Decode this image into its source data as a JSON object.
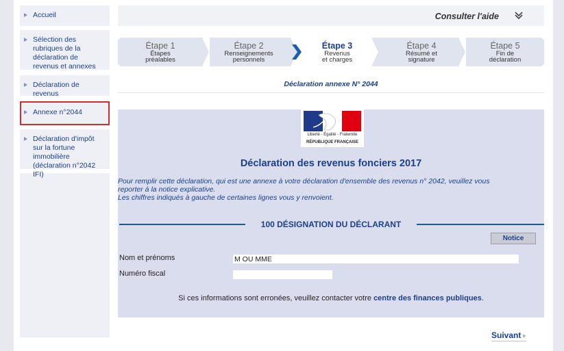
{
  "sidebar": {
    "items": [
      {
        "label": "Accueil"
      },
      {
        "label": "Sélection des rubriques de la déclaration de revenus et annexes"
      },
      {
        "label": "Déclaration de revenus"
      },
      {
        "label": "Annexe n°2044"
      },
      {
        "label": "Déclaration d'impôt sur la fortune immobilière (déclaration n°2042 IFI)"
      }
    ],
    "active_index": 3
  },
  "help": {
    "label": "Consulter l'aide"
  },
  "steps": [
    {
      "num": "Étape 1",
      "line1": "Étapes",
      "line2": "préalables"
    },
    {
      "num": "Étape 2",
      "line1": "Renseignements",
      "line2": "personnels"
    },
    {
      "num": "Étape 3",
      "line1": "Revenus",
      "line2": "et charges"
    },
    {
      "num": "Étape 4",
      "line1": "Résumé et",
      "line2": "signature"
    },
    {
      "num": "Étape 5",
      "line1": "Fin de",
      "line2": "déclaration"
    }
  ],
  "subtitle": "Déclaration annexe N° 2044",
  "logo": {
    "motto": "Liberté - Égalité - Fraternité",
    "republic": "RÉPUBLIQUE FRANÇAISE"
  },
  "form": {
    "title": "Déclaration des revenus fonciers 2017",
    "intro_line1": "Pour remplir cette déclaration, qui est une annexe à votre déclaration d'ensemble des revenus n° 2042, veuillez vous",
    "intro_line2": "reporter à la notice explicative.",
    "intro_line3": "Les chiffres indiqués à gauche de certaines lignes vous y renvoient.",
    "section_title": "100 DÉSIGNATION DU DÉCLARANT",
    "notice_label": "Notice",
    "name_label": "Nom et prénoms",
    "name_value": "M OU MME",
    "fiscal_label": "Numéro fiscal",
    "fiscal_value": "",
    "contact_prefix": "Si ces informations sont erronées, veuillez contacter votre ",
    "contact_link": "centre des finances publiques",
    "contact_suffix": "."
  },
  "next": {
    "label": "Suivant"
  },
  "colors": {
    "accent": "#1b3f8b",
    "panel": "#d9ddee",
    "active_outline": "#d9272e"
  }
}
